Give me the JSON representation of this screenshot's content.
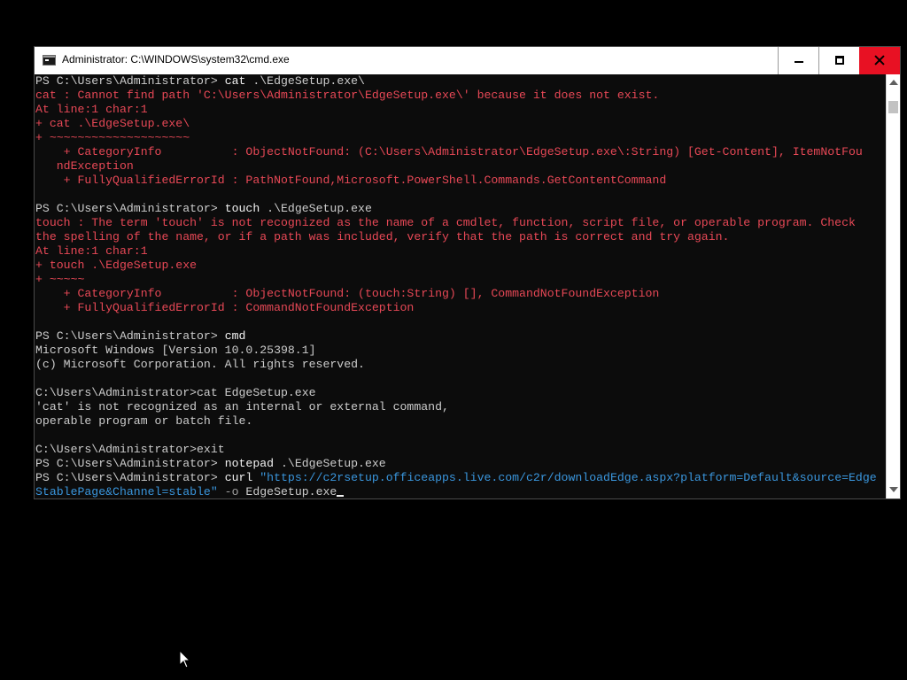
{
  "window": {
    "title": "Administrator: C:\\WINDOWS\\system32\\cmd.exe",
    "icons": {
      "app": "cmd-icon",
      "minimize": "minimize-icon",
      "maximize": "maximize-icon",
      "close": "close-icon"
    },
    "colors": {
      "close_hover": "#e81123",
      "error_text": "#e74856",
      "string_text": "#3a96dd",
      "console_bg": "#0c0c0c"
    }
  },
  "console": {
    "lines": [
      [
        {
          "t": "PS C:\\Users\\Administrator> "
        },
        {
          "t": "cat",
          "c": "cmd"
        },
        {
          "t": " .\\EdgeSetup.exe\\"
        }
      ],
      [
        {
          "t": "cat : Cannot find path 'C:\\Users\\Administrator\\EdgeSetup.exe\\' because it does not exist.",
          "c": "err"
        }
      ],
      [
        {
          "t": "At line:1 char:1",
          "c": "err"
        }
      ],
      [
        {
          "t": "+ cat .\\EdgeSetup.exe\\",
          "c": "err"
        }
      ],
      [
        {
          "t": "+ ~~~~~~~~~~~~~~~~~~~~",
          "c": "err"
        }
      ],
      [
        {
          "t": "    + CategoryInfo          : ObjectNotFound: (C:\\Users\\Administrator\\EdgeSetup.exe\\:String) [Get-Content], ItemNotFou",
          "c": "err"
        }
      ],
      [
        {
          "t": "   ndException",
          "c": "err"
        }
      ],
      [
        {
          "t": "    + FullyQualifiedErrorId : PathNotFound,Microsoft.PowerShell.Commands.GetContentCommand",
          "c": "err"
        }
      ],
      [
        {
          "t": ""
        }
      ],
      [
        {
          "t": "PS C:\\Users\\Administrator> "
        },
        {
          "t": "touch",
          "c": "cmd"
        },
        {
          "t": " .\\EdgeSetup.exe"
        }
      ],
      [
        {
          "t": "touch : The term 'touch' is not recognized as the name of a cmdlet, function, script file, or operable program. Check",
          "c": "err"
        }
      ],
      [
        {
          "t": "the spelling of the name, or if a path was included, verify that the path is correct and try again.",
          "c": "err"
        }
      ],
      [
        {
          "t": "At line:1 char:1",
          "c": "err"
        }
      ],
      [
        {
          "t": "+ touch .\\EdgeSetup.exe",
          "c": "err"
        }
      ],
      [
        {
          "t": "+ ~~~~~",
          "c": "err"
        }
      ],
      [
        {
          "t": "    + CategoryInfo          : ObjectNotFound: (touch:String) [], CommandNotFoundException",
          "c": "err"
        }
      ],
      [
        {
          "t": "    + FullyQualifiedErrorId : CommandNotFoundException",
          "c": "err"
        }
      ],
      [
        {
          "t": ""
        }
      ],
      [
        {
          "t": "PS C:\\Users\\Administrator> "
        },
        {
          "t": "cmd",
          "c": "cmd"
        }
      ],
      [
        {
          "t": "Microsoft Windows [Version 10.0.25398.1]"
        }
      ],
      [
        {
          "t": "(c) Microsoft Corporation. All rights reserved."
        }
      ],
      [
        {
          "t": ""
        }
      ],
      [
        {
          "t": "C:\\Users\\Administrator>cat EdgeSetup.exe"
        }
      ],
      [
        {
          "t": "'cat' is not recognized as an internal or external command,"
        }
      ],
      [
        {
          "t": "operable program or batch file."
        }
      ],
      [
        {
          "t": ""
        }
      ],
      [
        {
          "t": "C:\\Users\\Administrator>exit"
        }
      ],
      [
        {
          "t": "PS C:\\Users\\Administrator> "
        },
        {
          "t": "notepad",
          "c": "cmd"
        },
        {
          "t": " .\\EdgeSetup.exe"
        }
      ],
      [
        {
          "t": "PS C:\\Users\\Administrator> "
        },
        {
          "t": "curl",
          "c": "cmd"
        },
        {
          "t": " \"https://c2rsetup.officeapps.live.com/c2r/downloadEdge.aspx?platform=Default&source=Edge",
          "c": "str"
        }
      ],
      [
        {
          "t": "StablePage&Channel=stable\"",
          "c": "str"
        },
        {
          "t": " -o",
          "c": "par"
        },
        {
          "t": " EdgeSetup.exe"
        }
      ]
    ]
  },
  "desktop": {
    "pointer_icon": "mouse-pointer-icon"
  }
}
